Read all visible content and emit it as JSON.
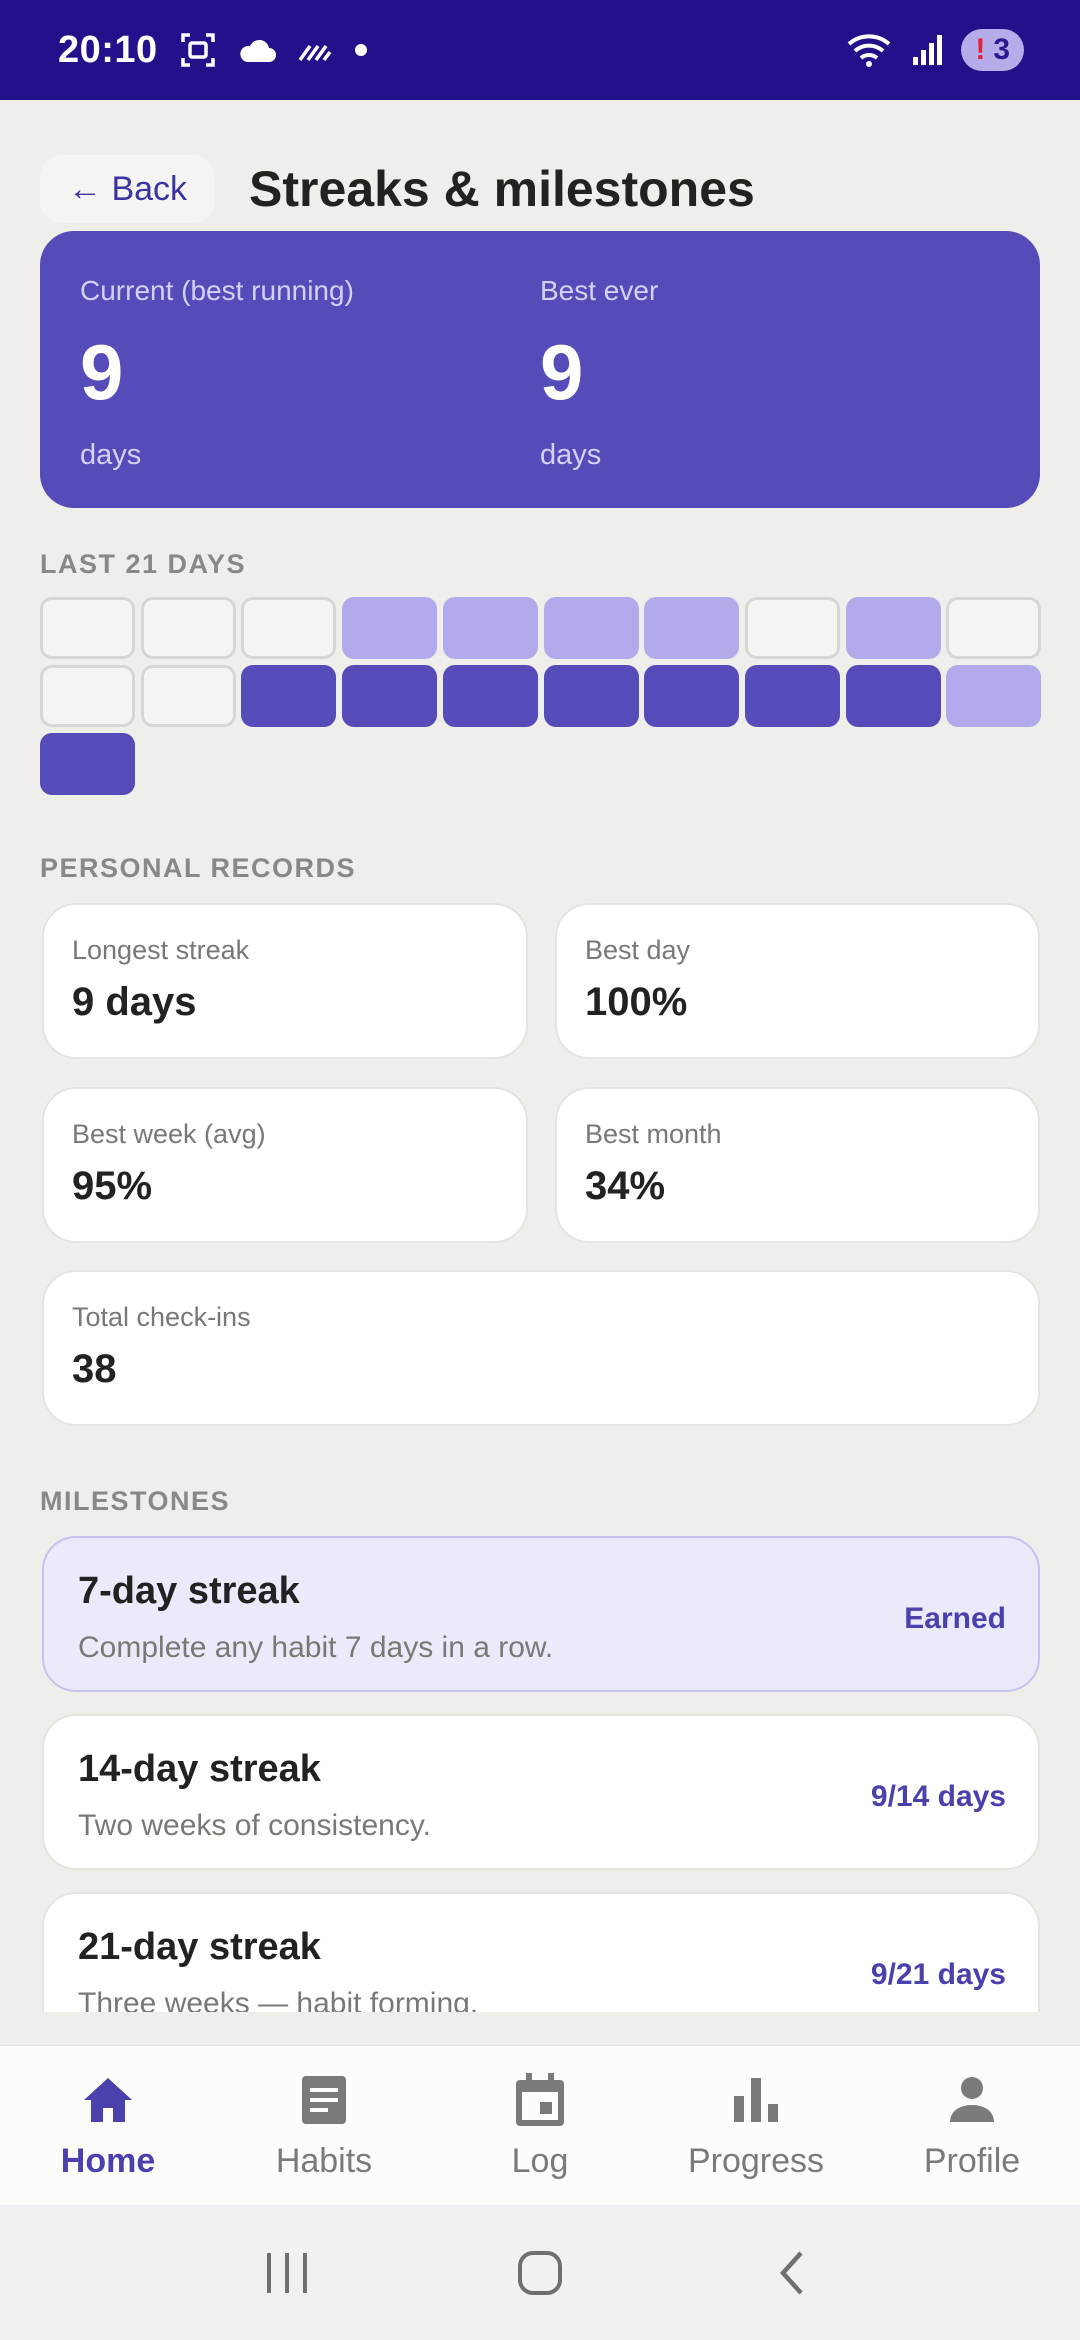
{
  "status_bar": {
    "time": "20:10",
    "badge_count": "3",
    "badge_mark": "!"
  },
  "header": {
    "back_label": "← Back",
    "title": "Streaks & milestones"
  },
  "streak": {
    "current_label": "Current (best running)",
    "current_value": "9",
    "current_unit": "days",
    "best_label": "Best ever",
    "best_value": "9",
    "best_unit": "days"
  },
  "last_days": {
    "label": "LAST 21 DAYS",
    "cells": [
      "empty",
      "empty",
      "empty",
      "light",
      "light",
      "light",
      "light",
      "empty",
      "light",
      "empty",
      "empty",
      "empty",
      "full",
      "full",
      "full",
      "full",
      "full",
      "full",
      "full",
      "light",
      "full"
    ]
  },
  "records": {
    "label": "PERSONAL RECORDS",
    "items": [
      {
        "label": "Longest streak",
        "value": "9 days"
      },
      {
        "label": "Best day",
        "value": "100%"
      },
      {
        "label": "Best week (avg)",
        "value": "95%"
      },
      {
        "label": "Best month",
        "value": "34%"
      },
      {
        "label": "Total check-ins",
        "value": "38"
      }
    ]
  },
  "milestones": {
    "label": "MILESTONES",
    "items": [
      {
        "title": "7-day streak",
        "desc": "Complete any habit 7 days in a row.",
        "status": "Earned"
      },
      {
        "title": "14-day streak",
        "desc": "Two weeks of consistency.",
        "status": "9/14 days"
      },
      {
        "title": "21-day streak",
        "desc": "Three weeks — habit forming.",
        "status": "9/21 days"
      }
    ]
  },
  "nav": {
    "items": [
      {
        "label": "Home",
        "icon": "home-icon"
      },
      {
        "label": "Habits",
        "icon": "habits-icon"
      },
      {
        "label": "Log",
        "icon": "calendar-icon"
      },
      {
        "label": "Progress",
        "icon": "bar-chart-icon"
      },
      {
        "label": "Profile",
        "icon": "person-icon"
      }
    ],
    "active": "Home"
  },
  "colors": {
    "accent": "#554cb9",
    "status_bar": "#23118c",
    "light_cell": "#b1aaeb"
  }
}
